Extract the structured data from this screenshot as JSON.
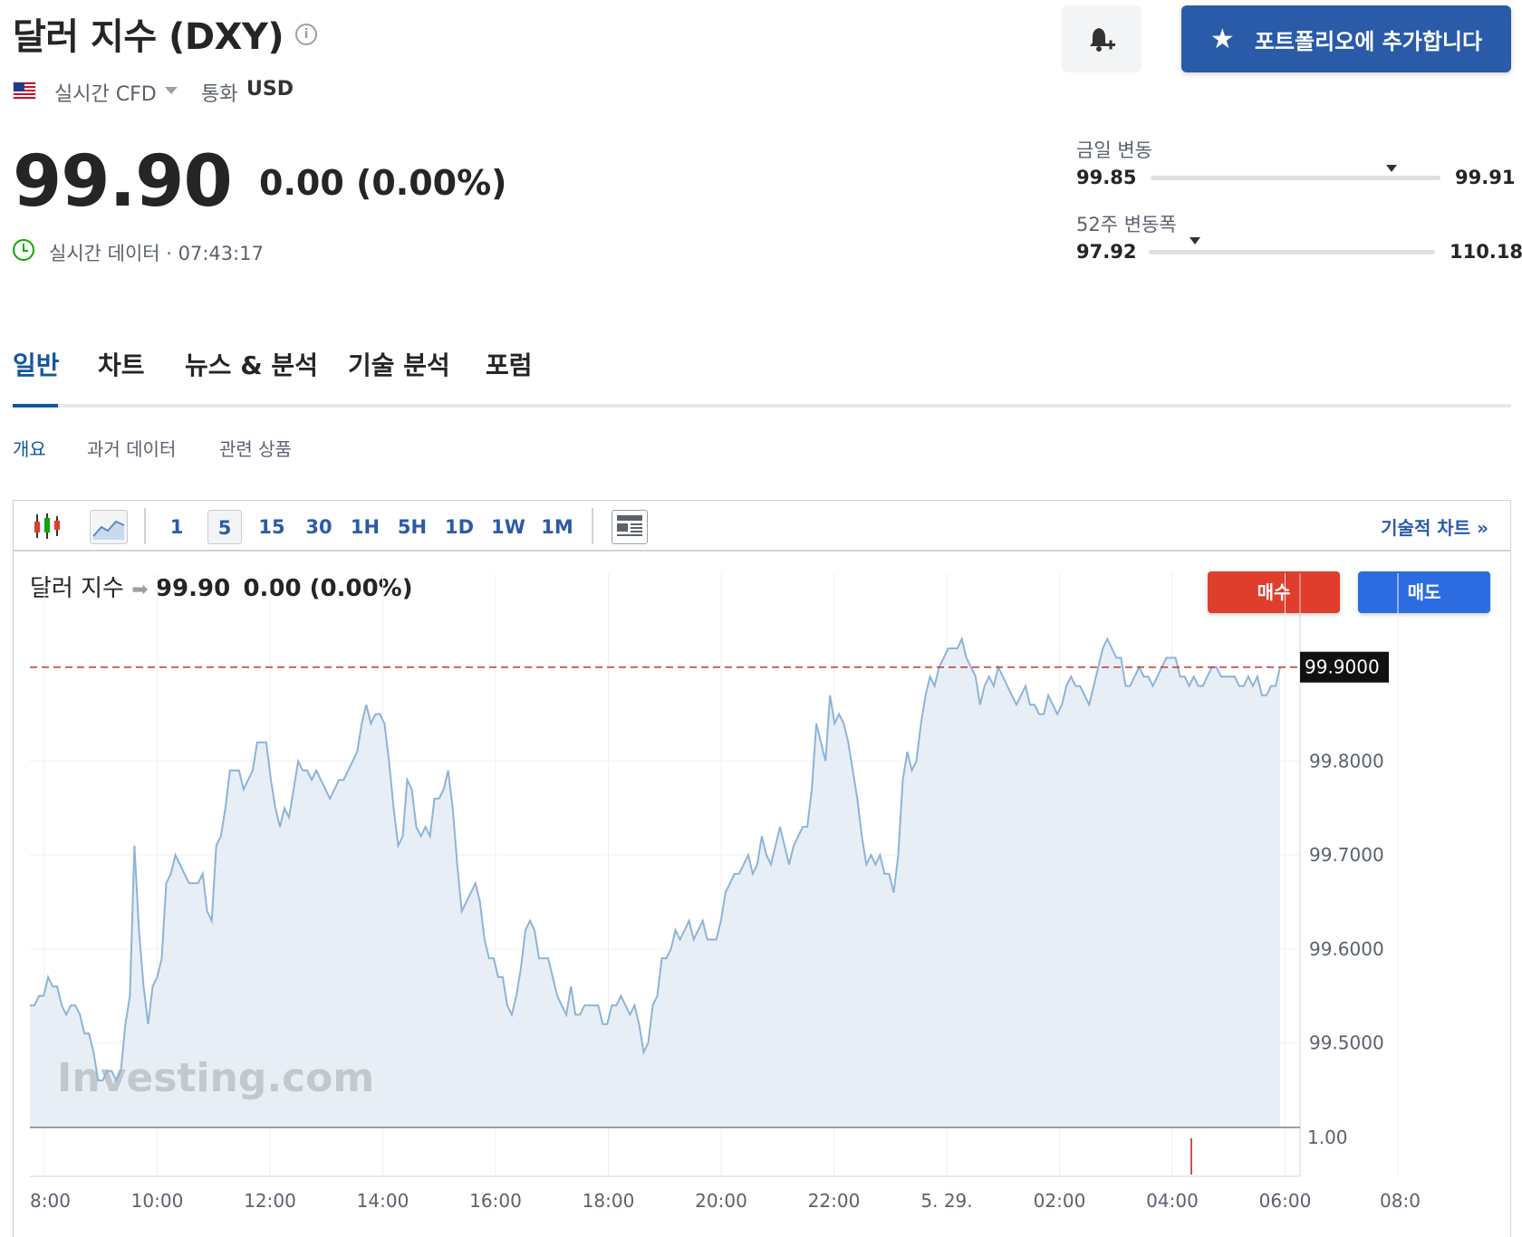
{
  "header": {
    "title": "달러 지수 (DXY)",
    "info_icon": "info-icon",
    "bell_icon": "bell-plus-icon",
    "add_portfolio_label": "포트폴리오에 추가합니다",
    "flag": "us-flag-icon",
    "realtime_label": "실시간 CFD",
    "currency_label": "통화",
    "currency_value": "USD"
  },
  "quote": {
    "price": "99.90",
    "change": "0.00 (0.00%)",
    "live_text": "실시간 데이터 · 07:43:17"
  },
  "ranges": {
    "day_label": "금일 변동",
    "day_low": "99.85",
    "day_high": "99.91",
    "day_position": 0.83,
    "week52_label": "52주 변동폭",
    "week52_low": "97.92",
    "week52_high": "110.18",
    "week52_position": 0.16
  },
  "tabs": [
    "일반",
    "차트",
    "뉴스 & 분석",
    "기술 분석",
    "포럼"
  ],
  "active_tab": "일반",
  "subtabs": [
    "개요",
    "과거 데이터",
    "관련 상품"
  ],
  "active_subtab": "개요",
  "chart_widget": {
    "toolbar_intervals": [
      "1",
      "5",
      "15",
      "30",
      "1H",
      "5H",
      "1D",
      "1W",
      "1M"
    ],
    "active_interval": "5",
    "tech_chart_link": "기술적 차트 »",
    "head_name": "달러 지수",
    "head_price": "99.90",
    "head_change": "0.00 (0.00%)",
    "buy_label": "매수",
    "sell_label": "매도",
    "watermark": "Investing.com",
    "volume_label": "1.00"
  },
  "chart_data": {
    "type": "area",
    "x_labels": [
      "8:00",
      "10:00",
      "12:00",
      "14:00",
      "16:00",
      "18:00",
      "20:00",
      "22:00",
      "5. 29.",
      "02:00",
      "04:00",
      "06:00",
      "08:0"
    ],
    "y_ticks": [
      "99.8000",
      "99.7000",
      "99.6000",
      "99.5000"
    ],
    "current_value_label": "99.9000",
    "current_value": 99.9,
    "ylim": [
      99.41,
      100.0
    ],
    "series": [
      {
        "values": [
          99.54,
          99.54,
          99.55,
          99.55,
          99.57,
          99.56,
          99.56,
          99.54,
          99.53,
          99.54,
          99.54,
          99.53,
          99.51,
          99.51,
          99.49,
          99.46,
          99.46,
          99.47,
          99.47,
          99.46,
          99.47,
          99.52,
          99.55,
          99.71,
          99.62,
          99.56,
          99.52,
          99.56,
          99.57,
          99.59,
          99.67,
          99.68,
          99.7,
          99.69,
          99.68,
          99.67,
          99.67,
          99.67,
          99.68,
          99.64,
          99.63,
          99.71,
          99.72,
          99.75,
          99.79,
          99.79,
          99.79,
          99.77,
          99.78,
          99.79,
          99.82,
          99.82,
          99.82,
          99.78,
          99.75,
          99.73,
          99.75,
          99.74,
          99.77,
          99.8,
          99.79,
          99.79,
          99.78,
          99.79,
          99.78,
          99.77,
          99.76,
          99.77,
          99.78,
          99.78,
          99.79,
          99.8,
          99.81,
          99.84,
          99.86,
          99.84,
          99.85,
          99.85,
          99.84,
          99.8,
          99.75,
          99.71,
          99.72,
          99.78,
          99.77,
          99.73,
          99.72,
          99.73,
          99.72,
          99.76,
          99.76,
          99.77,
          99.79,
          99.75,
          99.69,
          99.64,
          99.65,
          99.66,
          99.67,
          99.65,
          99.61,
          99.59,
          99.59,
          99.57,
          99.57,
          99.54,
          99.53,
          99.55,
          99.58,
          99.62,
          99.63,
          99.62,
          99.59,
          99.59,
          99.59,
          99.57,
          99.55,
          99.54,
          99.53,
          99.56,
          99.53,
          99.53,
          99.54,
          99.54,
          99.54,
          99.54,
          99.52,
          99.52,
          99.54,
          99.54,
          99.55,
          99.54,
          99.53,
          99.54,
          99.52,
          99.49,
          99.5,
          99.54,
          99.55,
          99.59,
          99.59,
          99.6,
          99.62,
          99.61,
          99.62,
          99.63,
          99.61,
          99.62,
          99.63,
          99.61,
          99.61,
          99.61,
          99.63,
          99.66,
          99.67,
          99.68,
          99.68,
          99.69,
          99.7,
          99.68,
          99.69,
          99.72,
          99.7,
          99.69,
          99.71,
          99.73,
          99.71,
          99.69,
          99.71,
          99.72,
          99.73,
          99.73,
          99.77,
          99.84,
          99.82,
          99.8,
          99.87,
          99.84,
          99.85,
          99.84,
          99.82,
          99.79,
          99.76,
          99.72,
          99.69,
          99.7,
          99.69,
          99.7,
          99.68,
          99.68,
          99.66,
          99.7,
          99.78,
          99.81,
          99.79,
          99.8,
          99.84,
          99.87,
          99.89,
          99.88,
          99.9,
          99.91,
          99.92,
          99.92,
          99.92,
          99.93,
          99.91,
          99.9,
          99.89,
          99.86,
          99.88,
          99.89,
          99.88,
          99.9,
          99.89,
          99.88,
          99.87,
          99.86,
          99.87,
          99.88,
          99.86,
          99.86,
          99.85,
          99.85,
          99.87,
          99.86,
          99.85,
          99.86,
          99.88,
          99.89,
          99.88,
          99.88,
          99.87,
          99.86,
          99.88,
          99.9,
          99.92,
          99.93,
          99.92,
          99.91,
          99.91,
          99.88,
          99.88,
          99.89,
          99.9,
          99.89,
          99.89,
          99.88,
          99.89,
          99.9,
          99.91,
          99.91,
          99.91,
          99.89,
          99.89,
          99.88,
          99.89,
          99.88,
          99.88,
          99.89,
          99.9,
          99.9,
          99.89,
          99.89,
          99.89,
          99.89,
          99.88,
          99.88,
          99.89,
          99.88,
          99.89,
          99.87,
          99.87,
          99.88,
          99.88,
          99.9
        ]
      }
    ],
    "grid": true,
    "current_line": "dashed-red"
  },
  "colors": {
    "brand_blue": "#2a5ba8",
    "tab_active": "#1256a0",
    "buy_red": "#e03e2d",
    "sell_blue": "#2d6ce0",
    "line": "#8eb3d8",
    "area_fill": "#e8eef6",
    "live_green": "#0ea600"
  }
}
